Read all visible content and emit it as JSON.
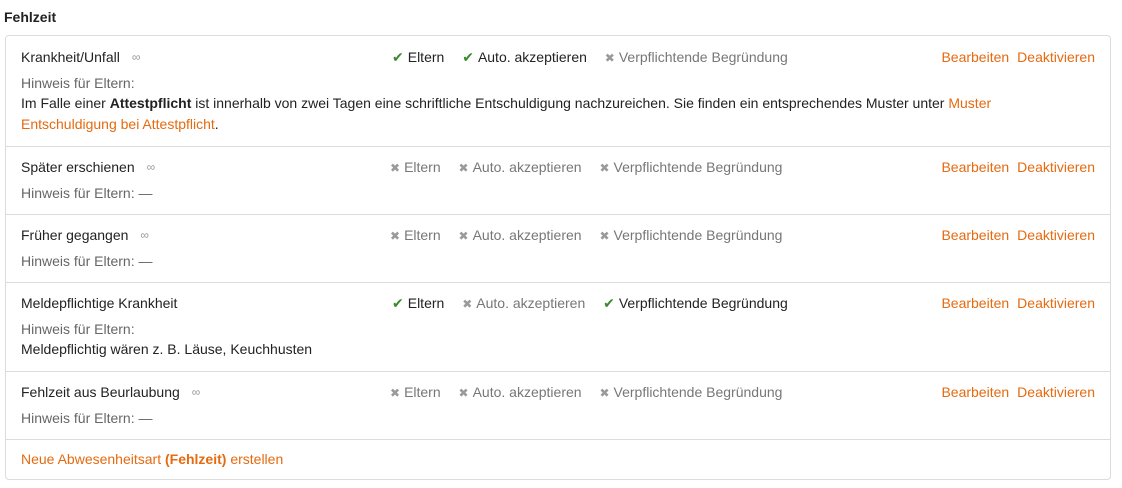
{
  "section_title": "Fehlzeit",
  "action_edit": "Bearbeiten",
  "action_deactivate": "Deaktivieren",
  "hint_label": "Hinweis für Eltern:",
  "hint_empty": "Hinweis für Eltern: —",
  "flag_labels": {
    "parents": "Eltern",
    "auto": "Auto. akzeptieren",
    "reason": "Verpflichtende Begründung"
  },
  "rows": [
    {
      "name": "Krankheit/Unfall",
      "glasses": true,
      "parents": true,
      "auto": true,
      "reason": false,
      "hint_prefix": "Im Falle einer ",
      "hint_bold": "Attestpflicht",
      "hint_middle": " ist innerhalb von zwei Tagen eine schriftliche Entschuldigung nachzureichen. Sie finden ein entsprechendes Muster unter ",
      "hint_link": "Muster Entschuldigung bei Attestpflicht",
      "hint_suffix": "."
    },
    {
      "name": "Später erschienen",
      "glasses": true,
      "parents": false,
      "auto": false,
      "reason": false
    },
    {
      "name": "Früher gegangen",
      "glasses": true,
      "parents": false,
      "auto": false,
      "reason": false
    },
    {
      "name": "Meldepflichtige Krankheit",
      "glasses": false,
      "parents": true,
      "auto": false,
      "reason": true,
      "hint_text": "Meldepflichtig wären z. B. Läuse, Keuchhusten"
    },
    {
      "name": "Fehlzeit aus Beurlaubung",
      "glasses": true,
      "parents": false,
      "auto": false,
      "reason": false
    }
  ],
  "new_link": {
    "prefix": "Neue Abwesenheitsart ",
    "bold": "(Fehlzeit)",
    "suffix": " erstellen"
  },
  "colors": {
    "accent": "#e56a10",
    "check": "#3b8a2f",
    "cross": "#9a9a9a"
  },
  "icons": {
    "check": "✔",
    "cross": "✖",
    "glasses": "👓"
  }
}
